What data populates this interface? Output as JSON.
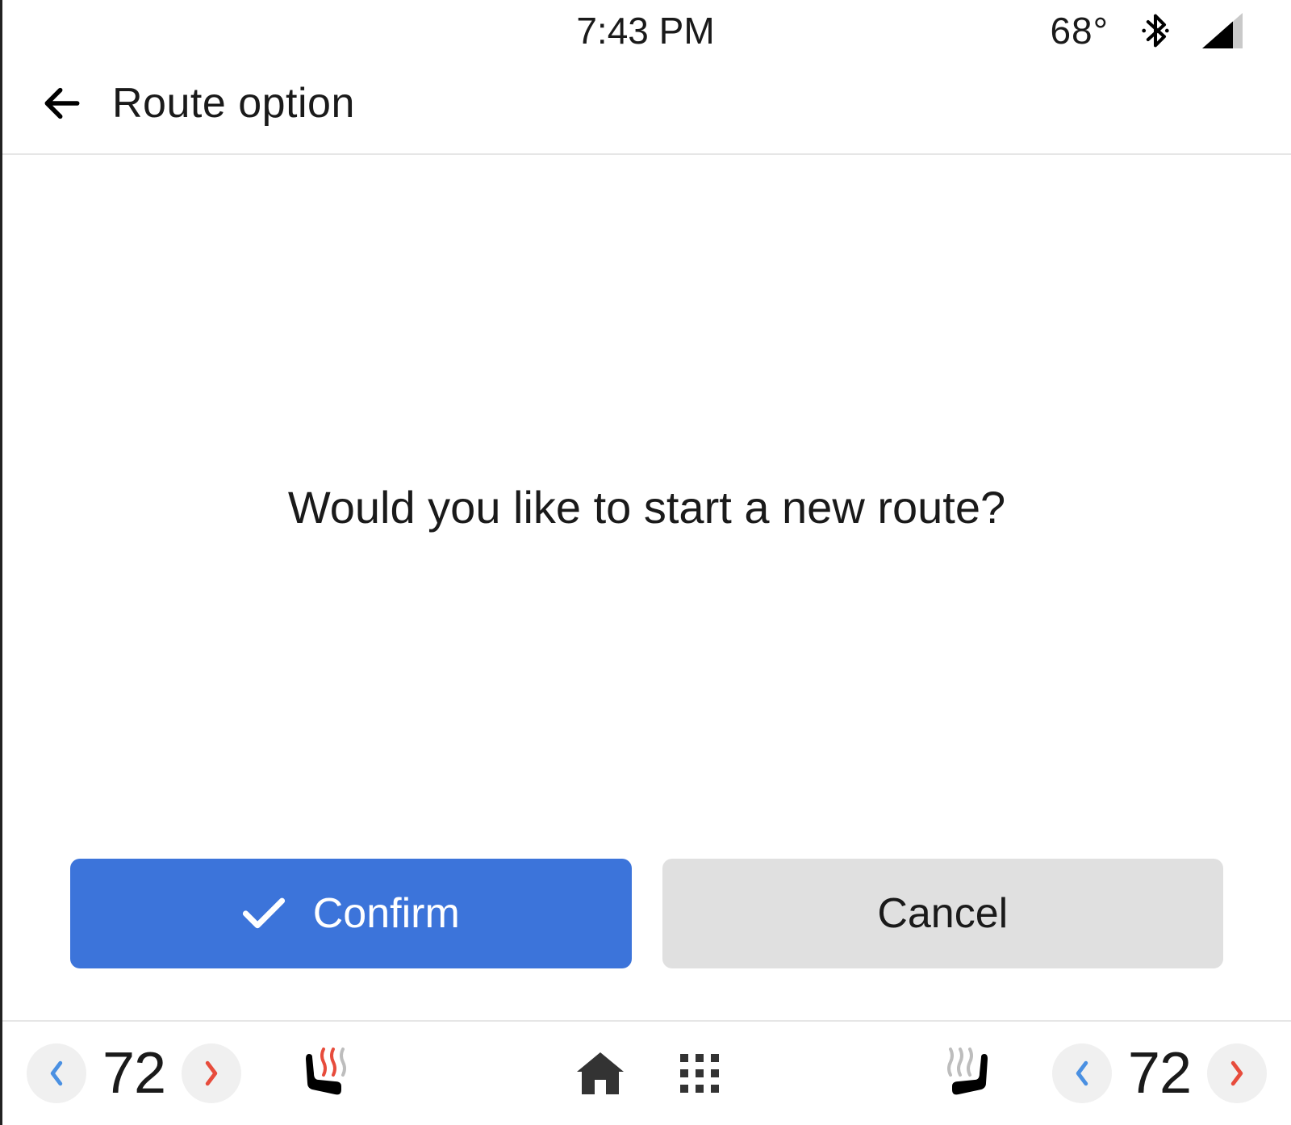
{
  "status": {
    "time": "7:43 PM",
    "outside_temp": "68°",
    "icons": {
      "bluetooth": "bluetooth-icon",
      "signal": "signal-icon"
    }
  },
  "header": {
    "back": "back-arrow-icon",
    "title": "Route option"
  },
  "prompt": {
    "question": "Would you like to start a new route?"
  },
  "actions": {
    "confirm_label": "Confirm",
    "cancel_label": "Cancel"
  },
  "bottom": {
    "left_temp": "72",
    "right_temp": "72",
    "colors": {
      "cool": "#4a90e2",
      "warm": "#e74c3c"
    },
    "icons": {
      "home": "home-icon",
      "apps": "apps-grid-icon",
      "seat_left": "heated-seat-left-icon",
      "seat_right": "heated-seat-right-icon"
    }
  }
}
